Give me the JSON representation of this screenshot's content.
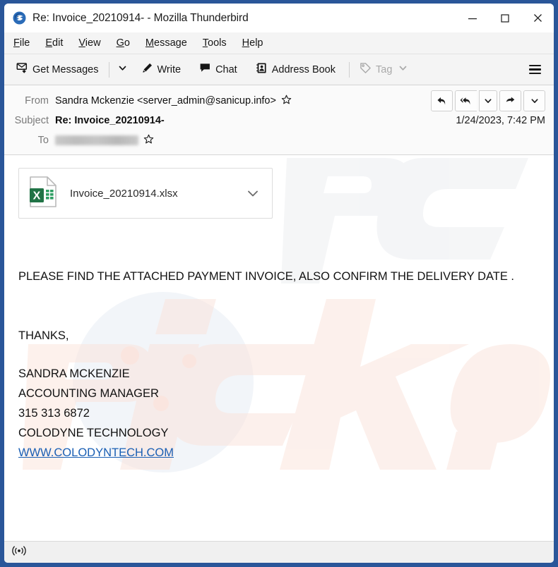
{
  "window": {
    "title": "Re: Invoice_20210914- - Mozilla Thunderbird",
    "app_icon": "thunderbird-logo-icon",
    "controls": {
      "minimize": "minimize-icon",
      "maximize": "maximize-icon",
      "close": "close-icon"
    }
  },
  "menu_bar": {
    "items": [
      {
        "label": "File",
        "accesskey": "F"
      },
      {
        "label": "Edit",
        "accesskey": "E"
      },
      {
        "label": "View",
        "accesskey": "V"
      },
      {
        "label": "Go",
        "accesskey": "G"
      },
      {
        "label": "Message",
        "accesskey": "M"
      },
      {
        "label": "Tools",
        "accesskey": "T"
      },
      {
        "label": "Help",
        "accesskey": "H"
      }
    ]
  },
  "toolbar": {
    "get_messages": "Get Messages",
    "get_messages_icon": "get-messages-icon",
    "get_messages_caret_icon": "chevron-down-icon",
    "write": "Write",
    "write_icon": "pencil-icon",
    "chat": "Chat",
    "chat_icon": "chat-bubble-icon",
    "address_book": "Address Book",
    "address_book_icon": "address-book-icon",
    "tag": "Tag",
    "tag_icon": "tag-icon",
    "tag_caret_icon": "chevron-down-icon",
    "tag_disabled": true,
    "menu_icon": "hamburger-menu-icon"
  },
  "message_header": {
    "from_label": "From",
    "from_value": "Sandra Mckenzie <server_admin@sanicup.info>",
    "from_star_icon": "star-outline-icon",
    "subject_label": "Subject",
    "subject_value": "Re: Invoice_20210914-",
    "date": "1/24/2023, 7:42 PM",
    "to_label": "To",
    "to_value": "",
    "to_redacted": true,
    "to_star_icon": "star-outline-icon",
    "actions": [
      {
        "name": "reply-button",
        "icon": "reply-icon"
      },
      {
        "name": "reply-all-button",
        "icon": "reply-all-icon"
      },
      {
        "name": "reply-all-dropdown",
        "icon": "chevron-down-icon"
      },
      {
        "name": "forward-button",
        "icon": "forward-arrow-icon"
      },
      {
        "name": "more-actions-dropdown",
        "icon": "chevron-down-icon"
      }
    ]
  },
  "attachment": {
    "filename": "Invoice_20210914.xlsx",
    "file_icon": "excel-file-icon",
    "expand_icon": "chevron-down-icon"
  },
  "body": {
    "paragraph_1": "PLEASE FIND THE ATTACHED PAYMENT INVOICE, ALSO CONFIRM THE DELIVERY DATE .",
    "closing": "THANKS,",
    "signature": {
      "name": "SANDRA MCKENZIE",
      "title": "ACCOUNTING MANAGER",
      "phone": "315 313 6872",
      "company": "COLODYNE TECHNOLOGY",
      "website": "WWW.COLODYNTECH.COM"
    }
  },
  "watermark": {
    "text": "pcrisk.com"
  },
  "status_bar": {
    "icon": "network-activity-icon"
  },
  "colors": {
    "window_border": "#2a5699",
    "toolbar_bg": "#f4f4f4",
    "header_bg": "#fafafa",
    "link": "#1a5fb4",
    "excel_green": "#217346",
    "disabled_text": "#a9a9a9"
  }
}
